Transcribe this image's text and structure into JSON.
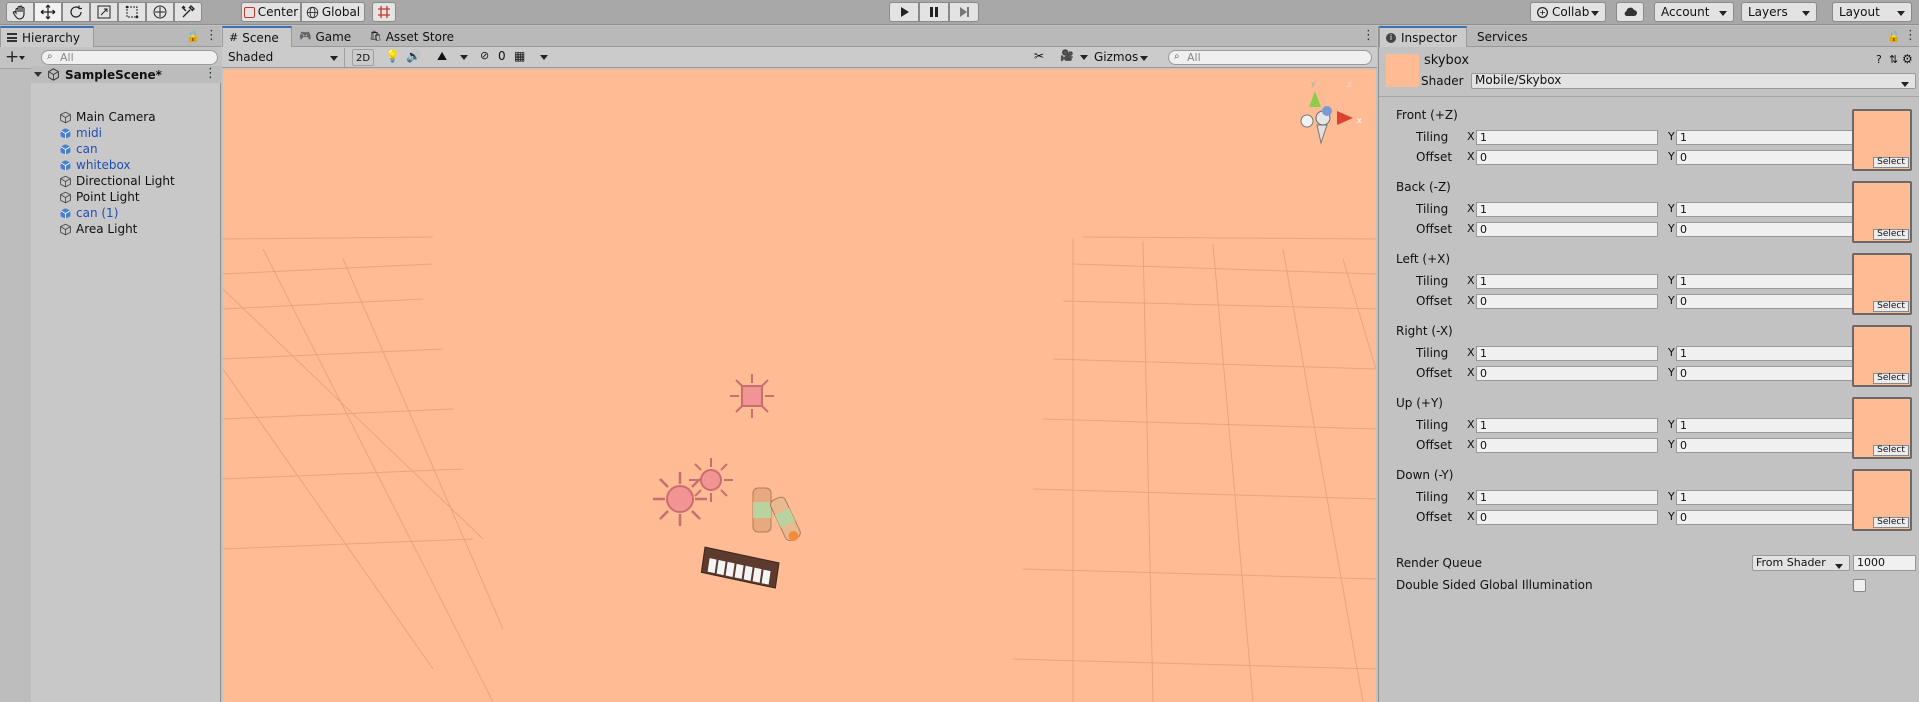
{
  "toolbar": {
    "tools": [
      "hand-tool",
      "move-tool",
      "rotate-tool",
      "scale-tool",
      "rect-tool",
      "transform-tool",
      "custom-editor-tool"
    ],
    "pivot_label": "Center",
    "space_label": "Global",
    "collab_label": "Collab",
    "account_label": "Account",
    "layers_label": "Layers",
    "layout_label": "Layout"
  },
  "hierarchy": {
    "tab_label": "Hierarchy",
    "search_placeholder": "All",
    "scene_name": "SampleScene*",
    "items": [
      {
        "label": "Main Camera",
        "prefab": false
      },
      {
        "label": "midi",
        "prefab": true
      },
      {
        "label": "can",
        "prefab": true
      },
      {
        "label": "whitebox",
        "prefab": true
      },
      {
        "label": "Directional Light",
        "prefab": false
      },
      {
        "label": "Point Light",
        "prefab": false
      },
      {
        "label": "can (1)",
        "prefab": true
      },
      {
        "label": "Area Light",
        "prefab": false
      }
    ]
  },
  "scene": {
    "tabs": [
      "Scene",
      "Game",
      "Asset Store"
    ],
    "shading_mode": "Shaded",
    "mode_2d": "2D",
    "hidden_count": "0",
    "gizmos_label": "Gizmos",
    "search_placeholder": "All",
    "background_color": "#ffbc94"
  },
  "inspector": {
    "tabs": [
      "Inspector",
      "Services"
    ],
    "material_name": "skybox",
    "shader_label": "Shader",
    "shader_value": "Mobile/Skybox",
    "tiling_label": "Tiling",
    "offset_label": "Offset",
    "x_label": "X",
    "y_label": "Y",
    "select_label": "Select",
    "textures": [
      {
        "label": "Front (+Z)",
        "tiling_x": "1",
        "tiling_y": "1",
        "offset_x": "0",
        "offset_y": "0"
      },
      {
        "label": "Back (-Z)",
        "tiling_x": "1",
        "tiling_y": "1",
        "offset_x": "0",
        "offset_y": "0"
      },
      {
        "label": "Left (+X)",
        "tiling_x": "1",
        "tiling_y": "1",
        "offset_x": "0",
        "offset_y": "0"
      },
      {
        "label": "Right (-X)",
        "tiling_x": "1",
        "tiling_y": "1",
        "offset_x": "0",
        "offset_y": "0"
      },
      {
        "label": "Up (+Y)",
        "tiling_x": "1",
        "tiling_y": "1",
        "offset_x": "0",
        "offset_y": "0"
      },
      {
        "label": "Down (-Y)",
        "tiling_x": "1",
        "tiling_y": "1",
        "offset_x": "0",
        "offset_y": "0"
      }
    ],
    "render_queue_label": "Render Queue",
    "render_queue_mode": "From Shader",
    "render_queue_value": "1000",
    "double_sided_label": "Double Sided Global Illumination",
    "swatch_color": "#ffbc94"
  },
  "colors": {
    "accent": "#3a72b0",
    "prefab_text": "#1f4fb0",
    "sky": "#ffbc94"
  }
}
